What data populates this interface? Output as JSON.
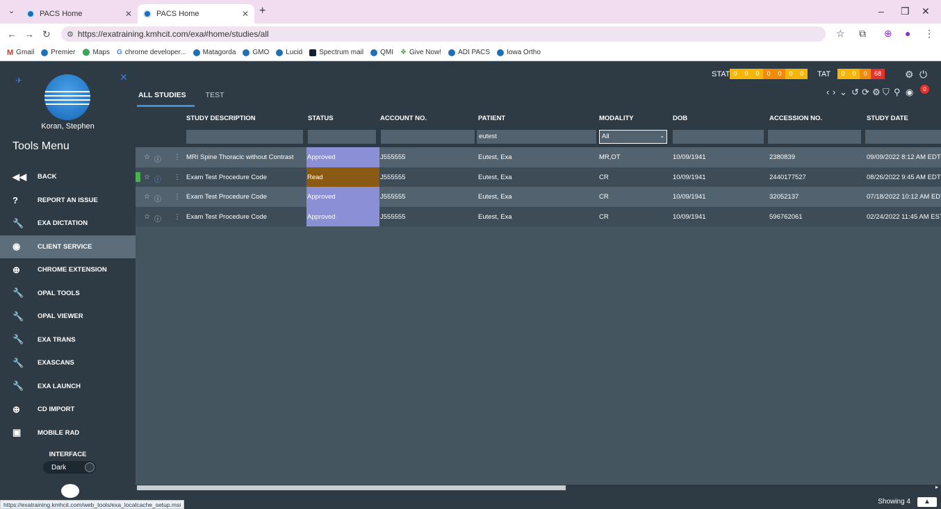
{
  "browser": {
    "tabs": [
      {
        "title": "PACS Home",
        "active": false
      },
      {
        "title": "PACS Home",
        "active": true
      }
    ],
    "url": "https://exatraining.kmhcit.com/exa#home/studies/all",
    "bookmarks": [
      "Gmail",
      "Premier",
      "Maps",
      "chrome developer...",
      "Matagorda",
      "GMO",
      "Lucid",
      "Spectrum mail",
      "QMI",
      "Give Now!",
      "ADI PACS",
      "Iowa Ortho"
    ],
    "status_url": "https://exatraining.kmhcit.com/web_tools/exa_localcache_setup.msi"
  },
  "sidebar": {
    "user_name": "Koran, Stephen",
    "title": "Tools Menu",
    "items": [
      {
        "label": "BACK",
        "icon": "back-icon",
        "glyph": "◀◀"
      },
      {
        "label": "REPORT AN ISSUE",
        "icon": "help-icon",
        "glyph": "?"
      },
      {
        "label": "EXA DICTATION",
        "icon": "wrench-icon",
        "glyph": "🔧"
      },
      {
        "label": "CLIENT SERVICE",
        "icon": "eye-icon",
        "glyph": "◉"
      },
      {
        "label": "CHROME EXTENSION",
        "icon": "globe-icon",
        "glyph": "⊕"
      },
      {
        "label": "OPAL TOOLS",
        "icon": "wrench-icon",
        "glyph": "🔧"
      },
      {
        "label": "OPAL VIEWER",
        "icon": "wrench-icon",
        "glyph": "🔧"
      },
      {
        "label": "EXA TRANS",
        "icon": "wrench-icon",
        "glyph": "🔧"
      },
      {
        "label": "EXASCANS",
        "icon": "wrench-icon",
        "glyph": "🔧"
      },
      {
        "label": "EXA LAUNCH",
        "icon": "wrench-icon",
        "glyph": "🔧"
      },
      {
        "label": "CD IMPORT",
        "icon": "globe-icon",
        "glyph": "⊕"
      },
      {
        "label": "MOBILE RAD",
        "icon": "wallet-icon",
        "glyph": "▣"
      }
    ],
    "active_item": "CLIENT SERVICE",
    "interface_label": "INTERFACE",
    "theme_toggle": "Dark"
  },
  "topbar": {
    "tabs": [
      "ALL STUDIES",
      "TEST"
    ],
    "stat_label": "STAT",
    "stat_counts": [
      "0",
      "0",
      "0",
      "0",
      "0",
      "0",
      "0"
    ],
    "tat_label": "TAT",
    "tat_counts": [
      "0",
      "0",
      "0",
      "68"
    ],
    "notification_count": "0"
  },
  "grid": {
    "columns": [
      "STUDY DESCRIPTION",
      "STATUS",
      "ACCOUNT NO.",
      "PATIENT",
      "MODALITY",
      "DOB",
      "ACCESSION NO.",
      "STUDY DATE"
    ],
    "filters": {
      "patient": "eutest",
      "modality": "All"
    },
    "rows": [
      {
        "description": "MRI Spine Thoracic without Contrast",
        "status": "Approved",
        "account": "J555555",
        "patient": "Eutest, Exa",
        "modality": "MR,OT",
        "dob": "10/09/1941",
        "accession": "2380839",
        "study_date": "09/09/2022 8:12 AM EDT"
      },
      {
        "description": "Exam Test Procedure Code",
        "status": "Read",
        "account": "J555555",
        "patient": "Eutest, Exa",
        "modality": "CR",
        "dob": "10/09/1941",
        "accession": "2440177527",
        "study_date": "08/26/2022 9:45 AM EDT"
      },
      {
        "description": "Exam Test Procedure Code",
        "status": "Approved",
        "account": "J555555",
        "patient": "Eutest, Exa",
        "modality": "CR",
        "dob": "10/09/1941",
        "accession": "32052137",
        "study_date": "07/18/2022 10:12 AM EDT"
      },
      {
        "description": "Exam Test Procedure Code",
        "status": "Approved",
        "account": "J555555",
        "patient": "Eutest, Exa",
        "modality": "CR",
        "dob": "10/09/1941",
        "accession": "596762061",
        "study_date": "02/24/2022 11:45 AM EST"
      }
    ],
    "showing": "Showing 4"
  }
}
